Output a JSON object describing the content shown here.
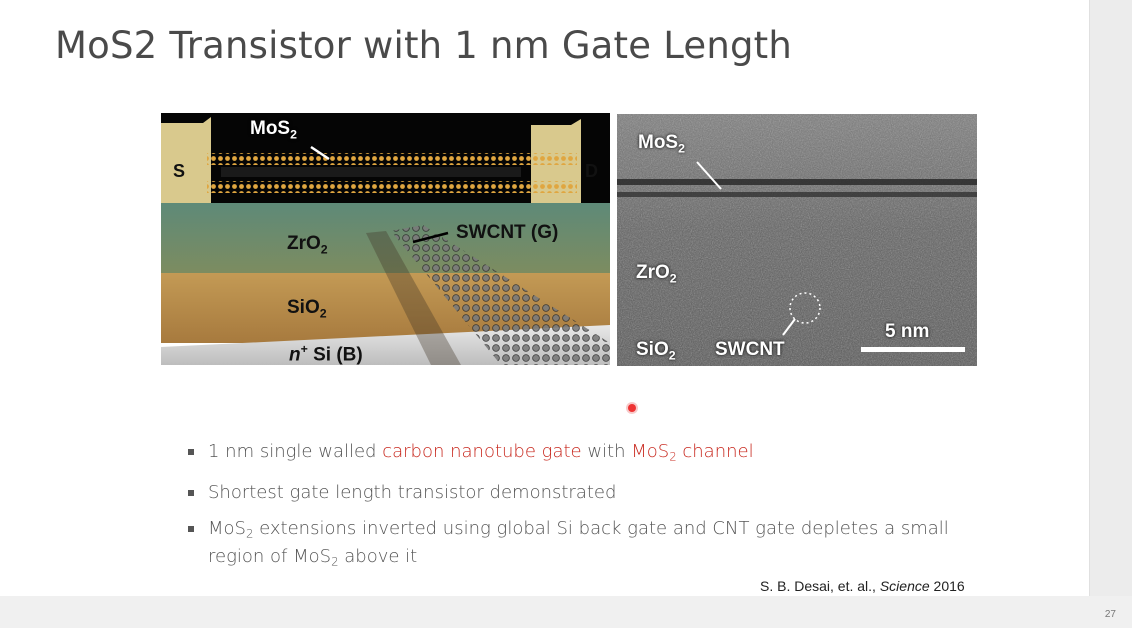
{
  "slide": {
    "title": "MoS2 Transistor with 1 nm Gate Length",
    "page_number": "27"
  },
  "figure_left": {
    "label_mos2": "MoS",
    "label_mos2_sub": "2",
    "label_s": "S",
    "label_d": "D",
    "label_zro2": "ZrO",
    "label_zro2_sub": "2",
    "label_sio2": "SiO",
    "label_sio2_sub": "2",
    "label_swcnt": "SWCNT (G)",
    "label_nsi_n": "n",
    "label_nsi_sup": "+",
    "label_nsi": " Si (B)"
  },
  "figure_right": {
    "label_mos2": "MoS",
    "label_mos2_sub": "2",
    "label_zro2": "ZrO",
    "label_zro2_sub": "2",
    "label_sio2": "SiO",
    "label_sio2_sub": "2",
    "label_swcnt": "SWCNT",
    "scale_bar": "5 nm"
  },
  "bullets": [
    {
      "t1": "1 nm single walled ",
      "r1": "carbon nanotube gate",
      "t2": " with ",
      "r2": "MoS",
      "r2_sub": "2",
      "r3": " channel"
    },
    {
      "t1": "Shortest gate length transistor demonstrated"
    },
    {
      "t1": "MoS",
      "t1_sub": "2",
      "t2": " extensions inverted using global Si back gate and CNT gate depletes a small region of MoS",
      "t2_sub": "2",
      "t3": " above it"
    }
  ],
  "citation": {
    "authors": "S. B. Desai, et. al., ",
    "journal": "Science",
    "year": " 2016"
  },
  "colors": {
    "accent_red": "#c8281e",
    "title_gray": "#4a4a4a"
  }
}
